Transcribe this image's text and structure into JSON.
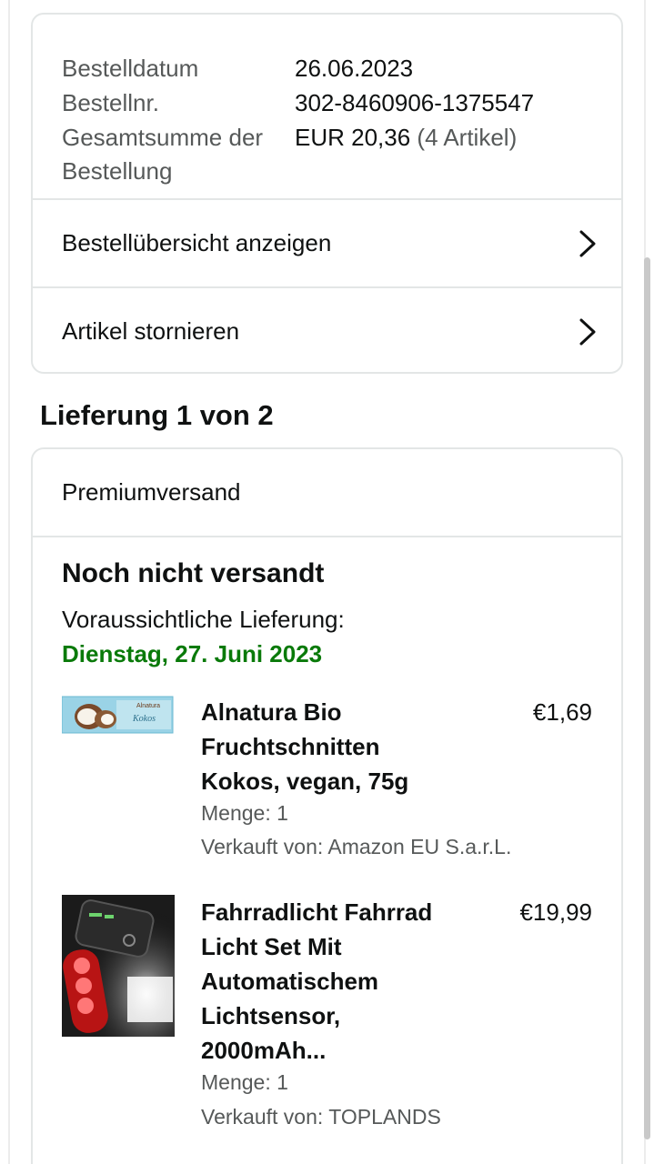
{
  "order_summary": {
    "order_date_label": "Bestelldatum",
    "order_date": "26.06.2023",
    "order_number_label": "Bestellnr.",
    "order_number": "302-8460906-1375547",
    "total_label": "Gesamtsumme der Bestellung",
    "total_value": "EUR 20,36",
    "total_items": "(4 Artikel)"
  },
  "actions": {
    "view_summary": "Bestellübersicht anzeigen",
    "cancel_items": "Artikel stornieren"
  },
  "shipment": {
    "title": "Lieferung 1 von 2",
    "method": "Premiumversand",
    "status": "Noch nicht versandt",
    "eta_label": "Voraussichtliche Lieferung:",
    "eta_date": "Dienstag, 27. Juni 2023",
    "items": [
      {
        "title": "Alnatura Bio Fruchtschnitten Kokos, vegan, 75g",
        "price": "€1,69",
        "quantity": "Menge: 1",
        "seller": "Verkauft von: Amazon EU S.a.r.L.",
        "image_text": "Kokos"
      },
      {
        "title": "Fahrradlicht Fahrrad Licht Set Mit Automatischem Lichtsensor, 2000mAh...",
        "price": "€19,99",
        "quantity": "Menge: 1",
        "seller": "Verkauft von: TOPLANDS"
      }
    ]
  },
  "colors": {
    "eta_green": "#0a7a0a",
    "border": "#e3e6e6",
    "muted_text": "#565959"
  },
  "icons": {
    "chevron": "chevron-right-icon"
  }
}
